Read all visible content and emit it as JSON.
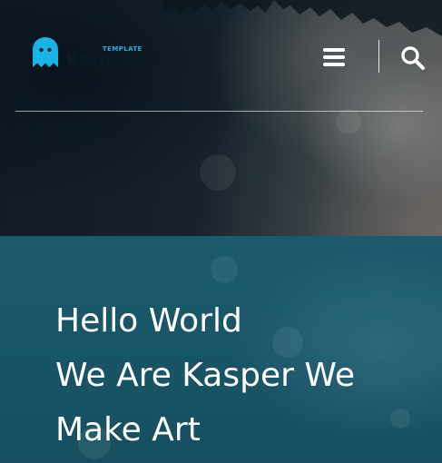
{
  "header": {
    "logo_tag": "TEMPLATE",
    "logo_word": "Kasper",
    "menu_icon": "hamburger-menu-icon",
    "search_icon": "search-icon"
  },
  "hero": {
    "lines": [
      "Hello World",
      "We Are Kasper We",
      "Make Art"
    ]
  },
  "colors": {
    "accent": "#19b4e6",
    "overlay_teal": "#1b5a6c",
    "text": "#ffffff"
  }
}
